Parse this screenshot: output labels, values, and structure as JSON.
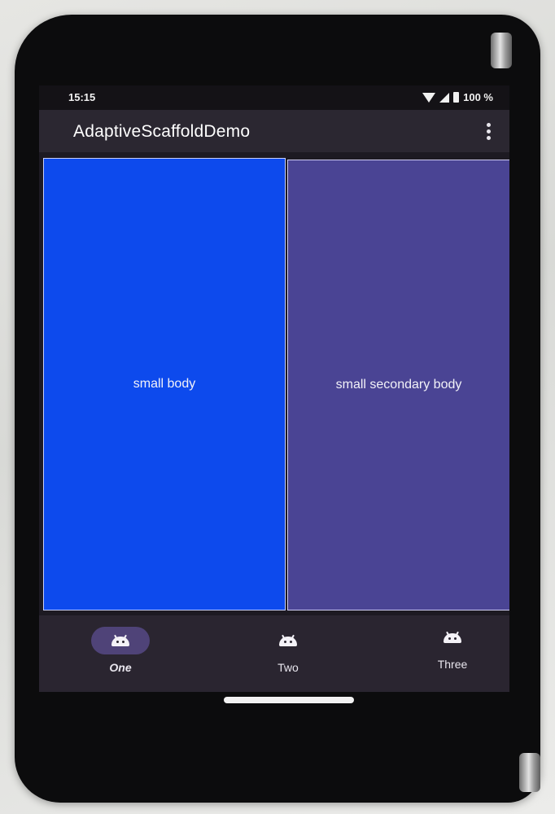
{
  "status_bar": {
    "time": "15:15",
    "battery": "100 %"
  },
  "app_bar": {
    "title": "AdaptiveScaffoldDemo",
    "overflow_icon": "more-vert-icon"
  },
  "panes": {
    "primary_label": "small body",
    "primary_color": "#0d4aed",
    "secondary_label": "small secondary body",
    "secondary_color": "#4a4494"
  },
  "navigation": {
    "items": [
      {
        "label": "One",
        "icon": "android-icon",
        "selected": true
      },
      {
        "label": "Two",
        "icon": "android-icon",
        "selected": false
      },
      {
        "label": "Three",
        "icon": "android-icon",
        "selected": false
      }
    ]
  }
}
